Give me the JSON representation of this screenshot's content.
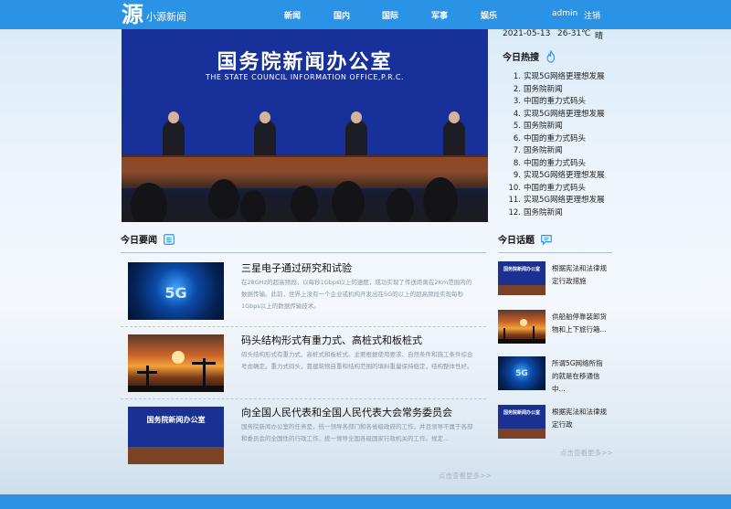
{
  "header": {
    "logo_mark": "源",
    "site_name": "小源新闻",
    "nav": [
      "新闻",
      "国内",
      "国际",
      "军事",
      "娱乐"
    ],
    "user": "admin",
    "logout": "注销"
  },
  "hero": {
    "title": "国务院新闻办公室",
    "subtitle": "THE STATE COUNCIL INFORMATION OFFICE,P.R.C."
  },
  "weather": {
    "date": "2021-05-13",
    "temp": "26-31℃",
    "condition": "晴"
  },
  "hot": {
    "title": "今日热搜",
    "icon": "flame-icon",
    "items": [
      {
        "n": "1.",
        "text": "实现5G网络更理想发展"
      },
      {
        "n": "2.",
        "text": "国务院新闻"
      },
      {
        "n": "3.",
        "text": "中国的重力式码头"
      },
      {
        "n": "4.",
        "text": "实现5G网络更理想发展"
      },
      {
        "n": "5.",
        "text": "国务院新闻"
      },
      {
        "n": "6.",
        "text": "中国的重力式码头"
      },
      {
        "n": "7.",
        "text": "国务院新闻"
      },
      {
        "n": "8.",
        "text": "中国的重力式码头"
      },
      {
        "n": "9.",
        "text": "实现5G网络更理想发展"
      },
      {
        "n": "10.",
        "text": "中国的重力式码头"
      },
      {
        "n": "11.",
        "text": "实现5G网络更理想发展"
      },
      {
        "n": "12.",
        "text": "国务院新闻"
      }
    ]
  },
  "news": {
    "title": "今日要闻",
    "icon": "list-icon",
    "items": [
      {
        "title": "三星电子通过研究和试验",
        "desc": "在28GHz的超高频段，以每秒1Gbps以上的速度，成功实现了传送距离在2Km范围内的数据传输。此前，世界上没有一个企业或机构开发出在5G的以上的超高频段实现每秒1Gbps以上的数据传输技术。",
        "image": "5g-tech-image"
      },
      {
        "title": "码头结构形式有重力式、高桩式和板桩式",
        "desc": "码头结构形式有重力式、高桩式和板桩式。主要根据使用要求、自然条件和施工条件综合考虑确定。重力式码头，靠建筑物自重和结构范围的填料重量保持稳定，结构整体性好。",
        "image": "oil-rig-sunset-image"
      },
      {
        "title": "向全国人民代表和全国人民代表大会常务委员会",
        "desc": "国务院新闻办公室的任务是，统一领导各部门和各省级政府的工作，并且领导不属于各部和委员会的全国性的行政工作，统一领导全国各级国家行政机关的工作。规定...",
        "image": "press-conference-image"
      }
    ],
    "more": "点击查看更多>>"
  },
  "topics": {
    "title": "今日话题",
    "icon": "chat-icon",
    "items": [
      {
        "text": "根据宪法和法律规定行政措施",
        "image": "press-conference-image"
      },
      {
        "text": "供船舶停靠装卸货物和上下旅行箱...",
        "image": "oil-rig-sunset-image"
      },
      {
        "text": "所谓5G网络所指的就是在移通信中...",
        "image": "5g-tech-image"
      },
      {
        "text": "根据宪法和法律规定行政",
        "image": "press-conference-image"
      }
    ],
    "more": "点击查看更多>>"
  },
  "colors": {
    "header_bg": "#2b93e6",
    "accent_icon": "#2b93e6",
    "muted_text": "#8a97a5"
  }
}
